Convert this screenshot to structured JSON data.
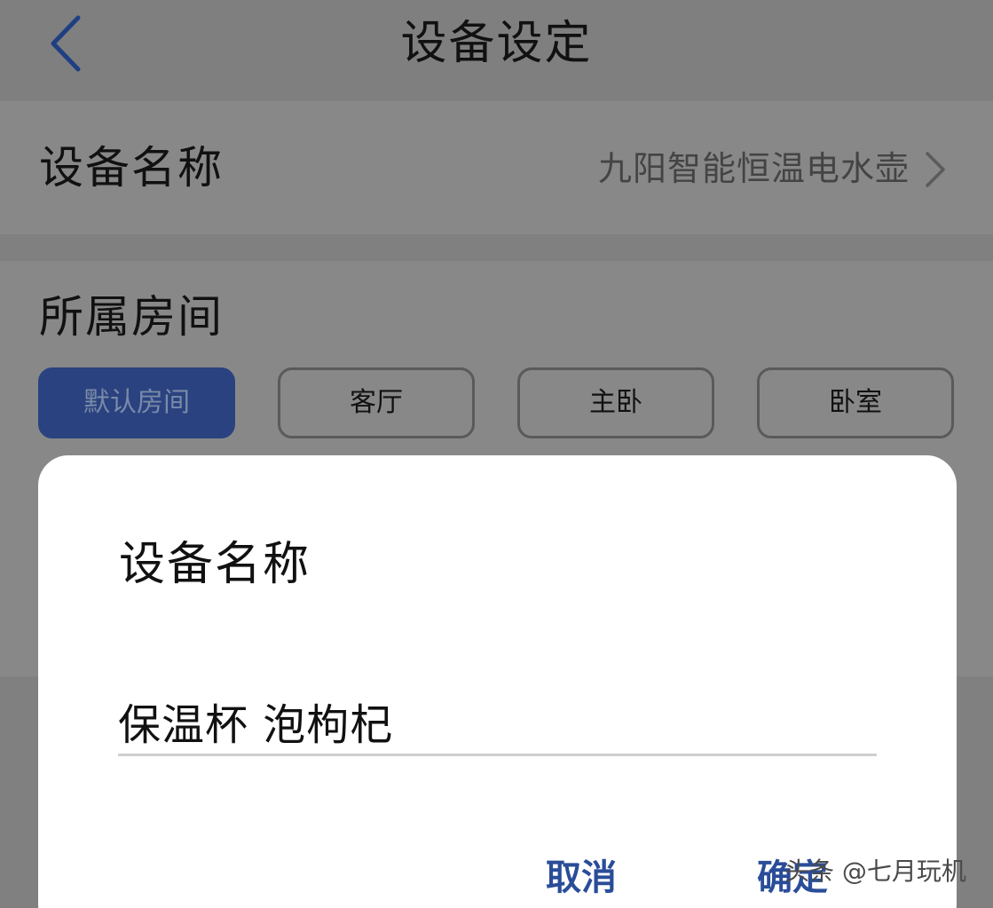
{
  "header": {
    "title": "设备设定",
    "back_icon": "chevron-left-icon"
  },
  "device_name_row": {
    "label": "设备名称",
    "value": "九阳智能恒温电水壶",
    "icon": "chevron-right-icon"
  },
  "room_section": {
    "label": "所属房间",
    "rooms": [
      {
        "label": "默认房间",
        "selected": true
      },
      {
        "label": "客厅",
        "selected": false
      },
      {
        "label": "主卧",
        "selected": false
      },
      {
        "label": "卧室",
        "selected": false
      }
    ]
  },
  "dialog": {
    "title": "设备名称",
    "input_value": "保温杯 泡枸杞",
    "cancel_label": "取消",
    "confirm_label": "确定"
  },
  "watermark": "头条 @七月玩机",
  "colors": {
    "accent": "#2a4d99",
    "selected_chip": "#2a4280",
    "overlay": "#808080"
  }
}
